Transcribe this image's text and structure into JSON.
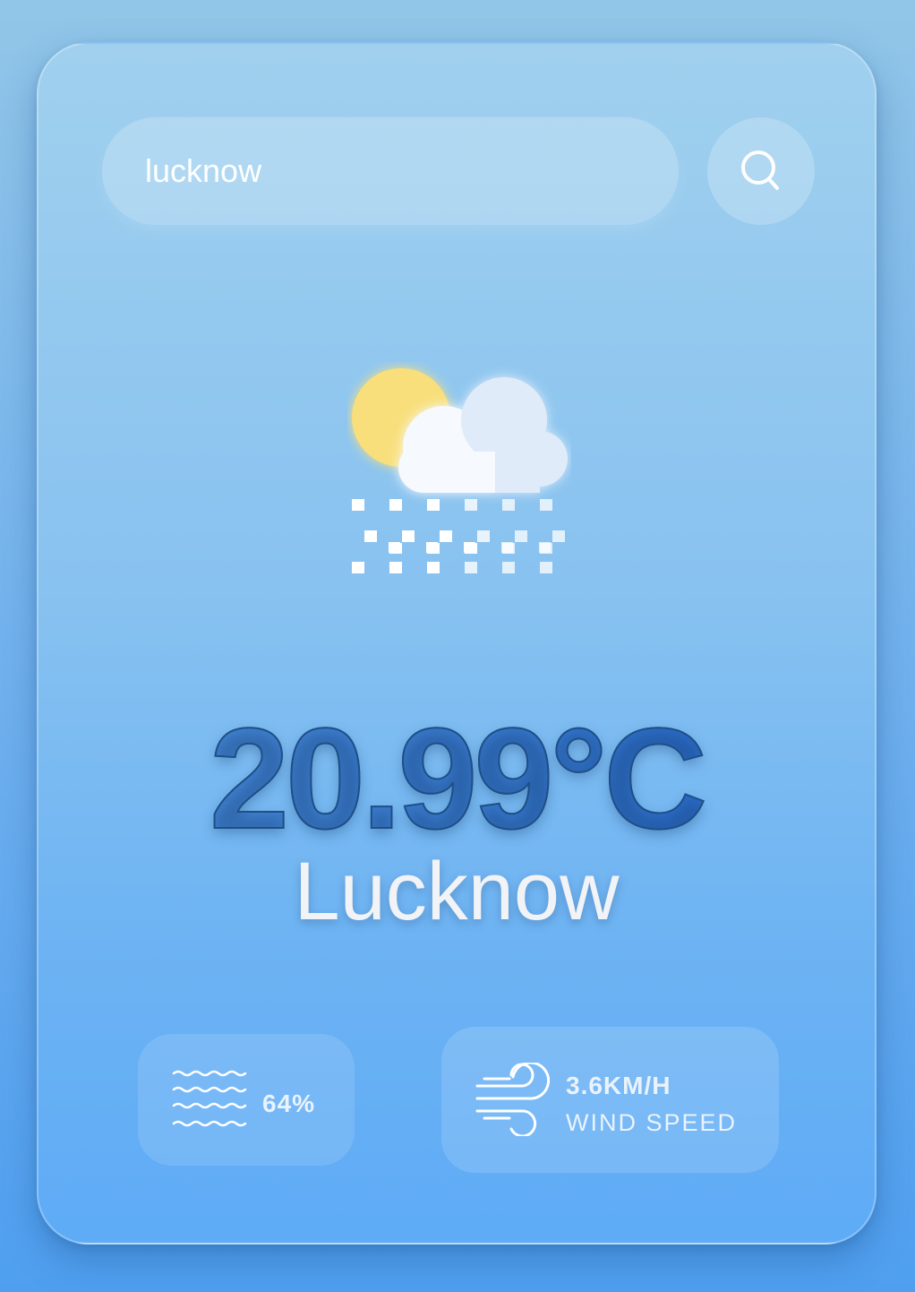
{
  "search": {
    "value": "lucknow",
    "button_icon": "search-icon"
  },
  "weather": {
    "icon": "partly-cloudy-snow-icon",
    "temperature": "20.99°C",
    "city": "Lucknow"
  },
  "humidity": {
    "icon": "humidity-waves-icon",
    "value": "64%"
  },
  "wind": {
    "icon": "wind-icon",
    "value": "3.6KM/H",
    "label": "WIND SPEED"
  },
  "colors": {
    "accent_temperature": "#3576cc",
    "text_light": "#f1f3f6",
    "sun": "#f8df7c"
  }
}
